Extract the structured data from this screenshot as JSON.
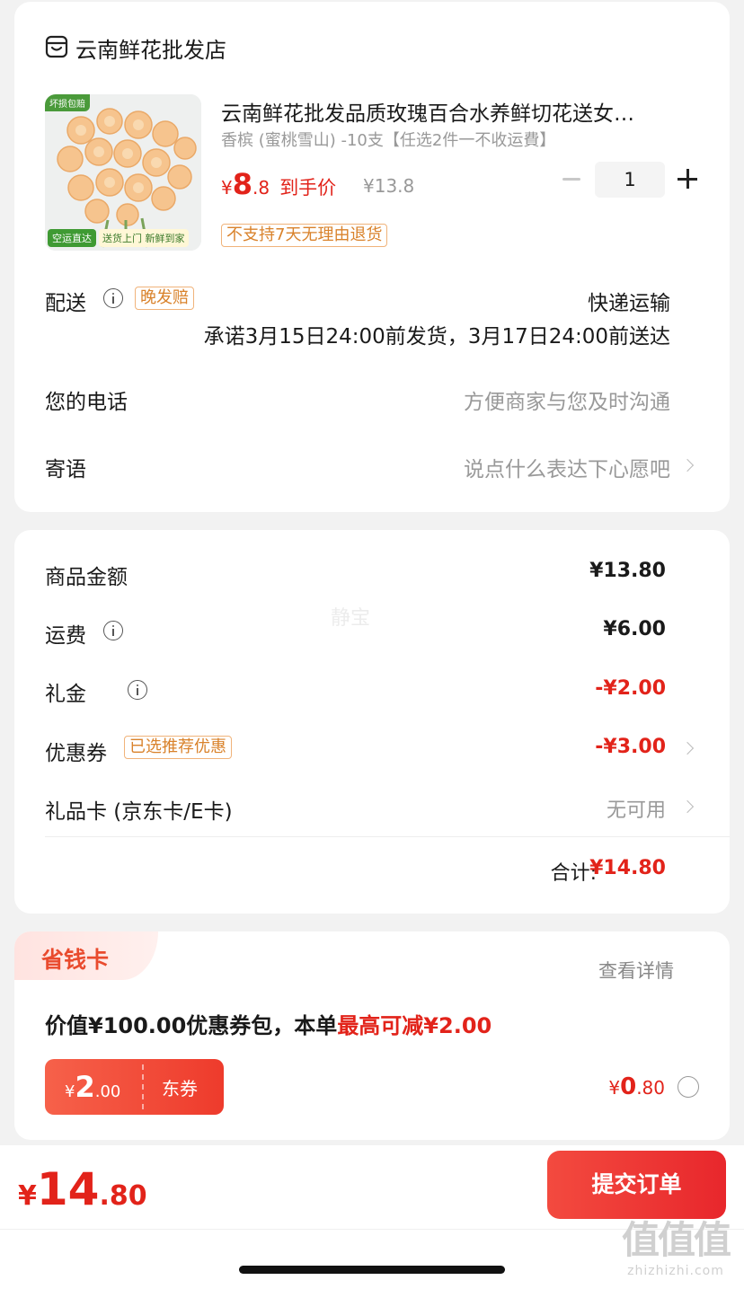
{
  "shop": {
    "name": "云南鲜花批发店",
    "product": {
      "title": "云南鲜花批发品质玫瑰百合水养鲜切花送女…",
      "variant": "香槟 (蜜桃雪山) -10支【任选2件一不收运費】",
      "image_badge_top": "坏损包赔",
      "image_badge_left": "空运直达",
      "image_badge_right1": "送货上门",
      "image_badge_right2": "新鲜到家",
      "price_symbol": "¥",
      "price_int": "8",
      "price_dec": ".8",
      "price_label": "到手价",
      "original_price": "¥13.8",
      "quantity": "1",
      "return_tag": "不支持7天无理由退货"
    },
    "delivery": {
      "label": "配送",
      "tag": "晚发赔",
      "method": "快递运输",
      "promise": "承诺3月15日24:00前发货，3月17日24:00前送达"
    },
    "phone": {
      "label": "您的电话",
      "placeholder": "方便商家与您及时沟通"
    },
    "message": {
      "label": "寄语",
      "placeholder": "说点什么表达下心愿吧"
    }
  },
  "summary": {
    "watermark": "静宝",
    "rows": [
      {
        "label": "商品金额",
        "value": "¥13.80"
      },
      {
        "label": "运费",
        "value": "¥6.00"
      },
      {
        "label": "礼金",
        "value": "-¥2.00"
      },
      {
        "label": "优惠券",
        "tag": "已选推荐优惠",
        "value": "-¥3.00"
      },
      {
        "label": "礼品卡 (京东卡/E卡)",
        "value": "无可用"
      }
    ],
    "total_label": "合计:",
    "total_value": "¥14.80"
  },
  "savings_card": {
    "title": "省钱卡",
    "details_link": "查看详情",
    "desc_prefix": "价值¥100.00优惠券包，本单",
    "desc_highlight": "最高可减¥2.00",
    "coupon_symbol": "¥",
    "coupon_int": "2",
    "coupon_dec": ".00",
    "coupon_label": "东券",
    "price_symbol": "¥",
    "price_int": "0",
    "price_dec": ".80"
  },
  "footer": {
    "total_symbol": "¥",
    "total_int": "14",
    "total_dec": ".80",
    "submit_label": "提交订单"
  },
  "watermark_site": {
    "logo": "值值值",
    "url": "zhizhizhi.com"
  },
  "colors": {
    "accent": "#e2231a",
    "button": "#ef3a35",
    "orange_tag": "#d9822b"
  }
}
